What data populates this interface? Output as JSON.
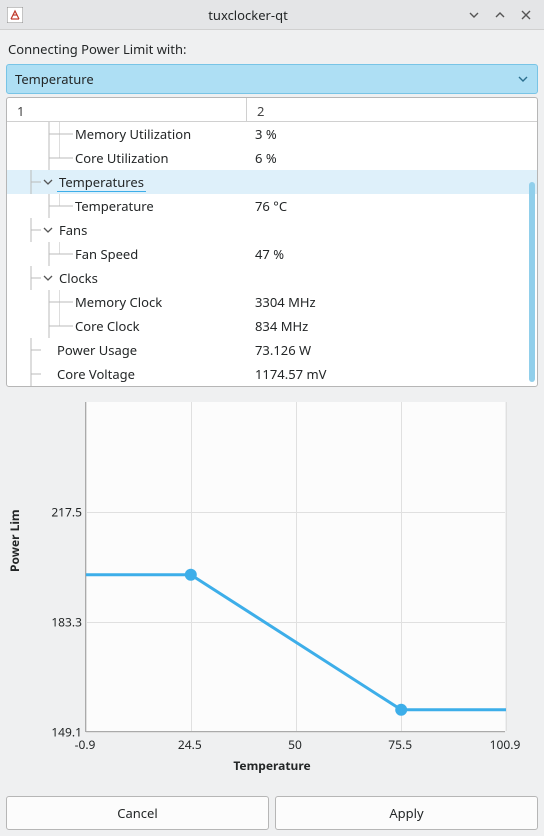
{
  "window": {
    "title": "tuxclocker-qt"
  },
  "header": {
    "connecting_label": "Connecting Power Limit with:"
  },
  "combo": {
    "selected": "Temperature"
  },
  "tree": {
    "col1": "1",
    "col2": "2",
    "rows": [
      {
        "label": "Memory Utilization",
        "value": "3 %"
      },
      {
        "label": "Core Utilization",
        "value": "6 %"
      },
      {
        "label": "Temperatures",
        "value": ""
      },
      {
        "label": "Temperature",
        "value": "76 °C"
      },
      {
        "label": "Fans",
        "value": ""
      },
      {
        "label": "Fan Speed",
        "value": "47 %"
      },
      {
        "label": "Clocks",
        "value": ""
      },
      {
        "label": "Memory Clock",
        "value": "3304 MHz"
      },
      {
        "label": "Core Clock",
        "value": "834 MHz"
      },
      {
        "label": "Power Usage",
        "value": "73.126 W"
      },
      {
        "label": "Core Voltage",
        "value": "1174.57 mV"
      }
    ]
  },
  "chart_data": {
    "type": "line",
    "xlabel": "Temperature",
    "ylabel": "Power Lim",
    "xlim": [
      -0.9,
      100.9
    ],
    "ylim": [
      149.1,
      251.7
    ],
    "x_ticks": [
      -0.9,
      24.5,
      50.0,
      75.5,
      100.9
    ],
    "y_ticks": [
      149.1,
      183.3,
      217.5
    ],
    "series": [
      {
        "name": "curve",
        "x": [
          -0.9,
          24.5,
          75.5,
          100.9
        ],
        "y": [
          198,
          198,
          156,
          156
        ]
      }
    ],
    "control_points": [
      {
        "x": 24.5,
        "y": 198
      },
      {
        "x": 75.5,
        "y": 156
      }
    ],
    "color": "#3daee9"
  },
  "buttons": {
    "cancel": "Cancel",
    "apply": "Apply"
  }
}
